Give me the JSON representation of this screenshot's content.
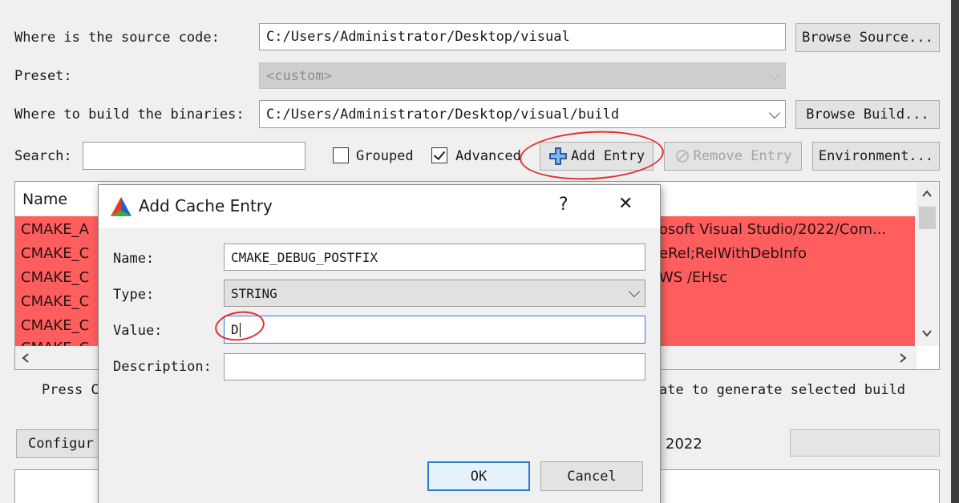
{
  "main": {
    "source_label": "Where is the source code:",
    "source_value": "C:/Users/Administrator/Desktop/visual",
    "browse_source": "Browse Source...",
    "preset_label": "Preset:",
    "preset_value": "<custom>",
    "build_label": "Where to build the binaries:",
    "build_value": "C:/Users/Administrator/Desktop/visual/build",
    "browse_build": "Browse Build...",
    "search_label": "Search:",
    "search_value": "",
    "grouped_label": "Grouped",
    "grouped_checked": false,
    "advanced_label": "Advanced",
    "advanced_checked": true,
    "add_entry": "Add Entry",
    "remove_entry": "Remove Entry",
    "environment": "Environment...",
    "table_header_name": "Name",
    "rows": [
      {
        "name": "CMAKE_A",
        "value": "osoft Visual Studio/2022/Com..."
      },
      {
        "name": "CMAKE_C",
        "value": "eRel;RelWithDebInfo"
      },
      {
        "name": "CMAKE_C",
        "value": "WS /EHsc"
      },
      {
        "name": "CMAKE_C",
        "value": ""
      },
      {
        "name": "CMAKE_C",
        "value": ""
      },
      {
        "name": "CMAKE_C",
        "value": ""
      }
    ],
    "press_text_left": "Press C",
    "press_text_right": "ate to generate selected build",
    "configure_button": "Configur",
    "generator_text": "2022"
  },
  "dialog": {
    "title": "Add Cache Entry",
    "help_glyph": "?",
    "close_glyph": "✕",
    "name_label": "Name:",
    "name_value": "CMAKE_DEBUG_POSTFIX",
    "type_label": "Type:",
    "type_value": "STRING",
    "value_label": "Value:",
    "value_value": "D",
    "description_label": "Description:",
    "description_value": "",
    "ok_button": "OK",
    "cancel_button": "Cancel"
  },
  "colors": {
    "row_red": "#ff5e5e",
    "annotation_red": "#e23030",
    "focus_blue": "#2e7bd6"
  }
}
